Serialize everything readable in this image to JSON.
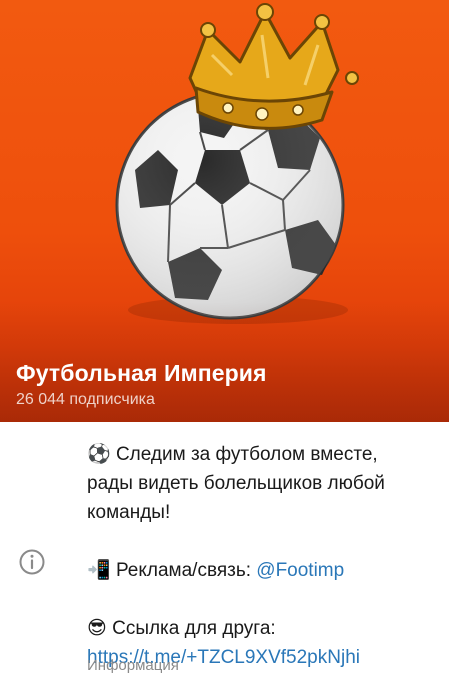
{
  "channel": {
    "title": "Футбольная Империя",
    "subscribers": "26 044 подписчика"
  },
  "description": {
    "line1_emoji": "⚽",
    "line1_text": " Следим за футболом вместе,",
    "line2": "рады видеть болельщиков любой",
    "line3": "команды!",
    "ads_emoji": "📲",
    "ads_label": " Реклама/связь: ",
    "ads_handle": "@Footimp",
    "friend_emoji": "😎",
    "friend_label": " Ссылка для друга:",
    "invite_link": "https://t.me/+TZCL9XVf52pkNjhi"
  },
  "info_label": "Информация",
  "icons": {
    "info": "info-circle-icon",
    "avatar": "football-crown-avatar"
  },
  "colors": {
    "header_orange": "#f25a10",
    "link_blue": "#2a77b8",
    "muted_gray": "#8a8a8a"
  }
}
